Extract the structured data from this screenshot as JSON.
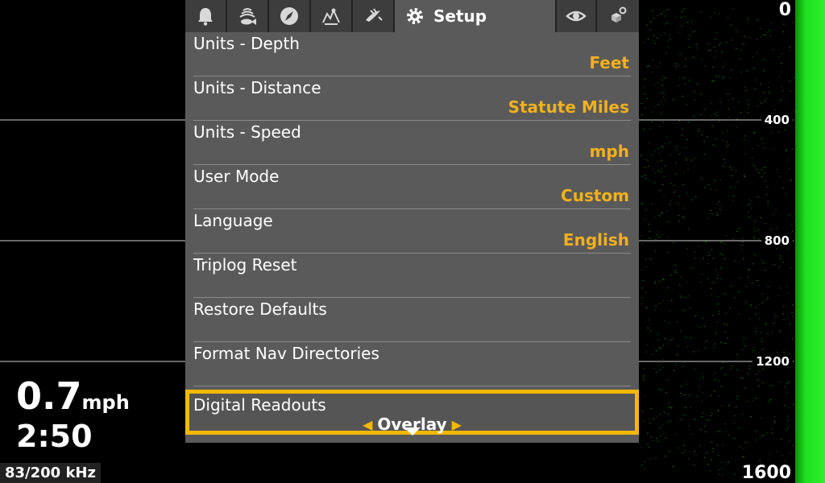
{
  "menu": {
    "tabs": [
      {
        "icon": "alarm-bell-icon"
      },
      {
        "icon": "fish-sonar-icon"
      },
      {
        "icon": "navigation-compass-icon"
      },
      {
        "icon": "chart-map-icon"
      },
      {
        "icon": "fish-id-icon"
      }
    ],
    "active_tab": {
      "label": "Setup",
      "icon": "gear-icon"
    },
    "right_tabs": [
      {
        "icon": "eye-icon"
      },
      {
        "icon": "accessories-icon"
      }
    ],
    "items": [
      {
        "label": "Units - Depth",
        "value": "Feet"
      },
      {
        "label": "Units - Distance",
        "value": "Statute Miles"
      },
      {
        "label": "Units - Speed",
        "value": "mph"
      },
      {
        "label": "User Mode",
        "value": "Custom"
      },
      {
        "label": "Language",
        "value": "English"
      },
      {
        "label": "Triplog Reset",
        "value": ""
      },
      {
        "label": "Restore Defaults",
        "value": ""
      },
      {
        "label": "Format Nav Directories",
        "value": ""
      }
    ],
    "selected_item": {
      "label": "Digital Readouts",
      "value": "Overlay"
    }
  },
  "sonar": {
    "depth_labels": [
      "0",
      "400",
      "800",
      "1200",
      "1600"
    ],
    "speed_value": "0.7",
    "speed_unit": "mph",
    "time": "2:50",
    "frequency": "83/200 kHz",
    "colors": {
      "accent": "#f5b800",
      "value_text": "#f2b01e",
      "bottom_bar": "#20e020"
    }
  }
}
